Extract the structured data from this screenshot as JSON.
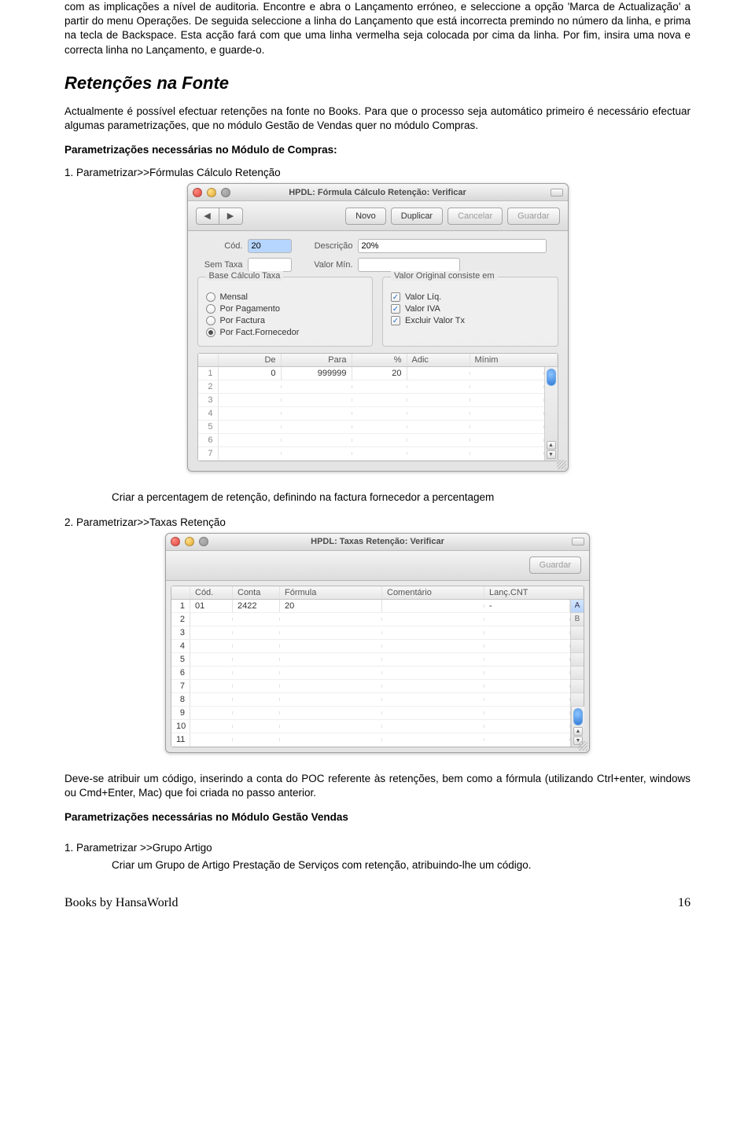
{
  "para1": "com as implicações a nível de auditoria. Encontre e abra o Lançamento erróneo, e seleccione a opção 'Marca de Actualização' a partir do menu Operações. De seguida seleccione a linha do Lançamento que está incorrecta premindo no número da linha, e prima na tecla de Backspace. Esta acção fará com que uma linha vermelha seja colocada por cima da linha. Por fim, insira uma nova e correcta linha no Lançamento, e guarde-o.",
  "h2": "Retenções na Fonte",
  "para2": "Actualmente é possível efectuar retenções na fonte no Books. Para que o processo seja automático primeiro é necessário efectuar algumas parametrizações, que no módulo Gestão de Vendas quer no módulo Compras.",
  "bold1": "Parametrizações necessárias no Módulo de Compras:",
  "step1": "1. Parametrizar>>Fórmulas Cálculo Retenção",
  "caption1": "Criar a percentagem de retenção, definindo na factura fornecedor a percentagem",
  "step2": "2. Parametrizar>>Taxas Retenção",
  "para3": "Deve-se atribuir um código, inserindo a conta do POC referente às retenções, bem como a fórmula (utilizando Ctrl+enter, windows ou Cmd+Enter, Mac) que foi criada no passo anterior.",
  "bold2": "Parametrizações necessárias no Módulo Gestão Vendas",
  "step3": "1. Parametrizar >>Grupo Artigo",
  "caption3": "Criar um Grupo de Artigo Prestação de Serviços com retenção, atribuindo-lhe um código.",
  "footerL": "Books by HansaWorld",
  "footerR": "16",
  "win1": {
    "title": "HPDL: Fórmula Cálculo Retenção: Verificar",
    "nav_prev": "◀",
    "nav_next": "▶",
    "btn_novo": "Novo",
    "btn_dup": "Duplicar",
    "btn_cancel": "Cancelar",
    "btn_save": "Guardar",
    "lbl_cod": "Cód.",
    "val_cod": "20",
    "lbl_desc": "Descrição",
    "val_desc": "20%",
    "lbl_semtaxa": "Sem Taxa",
    "lbl_valormin": "Valor Mín.",
    "grp1": "Base Cálculo Taxa",
    "r_mensal": "Mensal",
    "r_porpag": "Por Pagamento",
    "r_porfact": "Por Factura",
    "r_porfactforn": "Por Fact.Fornecedor",
    "grp2": "Valor Original consiste em",
    "c_valorliq": "Valor Líq.",
    "c_valoriva": "Valor IVA",
    "c_excl": "Excluir Valor Tx",
    "gh_de": "De",
    "gh_para": "Para",
    "gh_pct": "%",
    "gh_adic": "Adic",
    "gh_min": "Mínim",
    "g_de1": "0",
    "g_para1": "999999",
    "g_pct1": "20"
  },
  "win2": {
    "title": "HPDL: Taxas Retenção: Verificar",
    "btn_save": "Guardar",
    "h_cod": "Cód.",
    "h_conta": "Conta",
    "h_form": "Fórmula",
    "h_com": "Comentário",
    "h_lanc": "Lanç.CNT",
    "r1_cod": "01",
    "r1_conta": "2422",
    "r1_form": "20",
    "r1_lanc": "-",
    "sideA": "A",
    "sideB": "B"
  }
}
